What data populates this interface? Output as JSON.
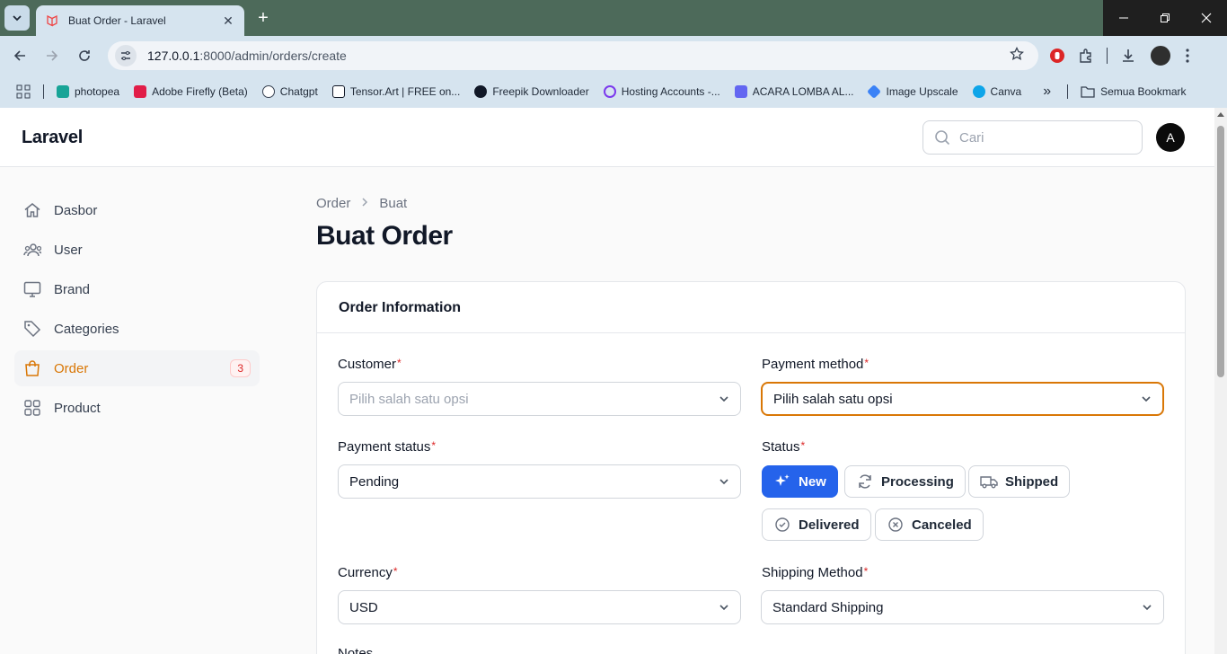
{
  "browser": {
    "tab_title": "Buat Order - Laravel",
    "url_host": "127.0.0.1",
    "url_rest": ":8000/admin/orders/create",
    "bookmarks": [
      {
        "label": "photopea",
        "color": "#18a497"
      },
      {
        "label": "Adobe Firefly (Beta)",
        "color": "#e11d48"
      },
      {
        "label": "Chatgpt",
        "color": "#6b7280"
      },
      {
        "label": "Tensor.Art | FREE on...",
        "color": "#111827"
      },
      {
        "label": "Freepik Downloader",
        "color": "#111827"
      },
      {
        "label": "Hosting Accounts -...",
        "color": "#7c3aed"
      },
      {
        "label": "ACARA LOMBA AL...",
        "color": "#6366f1"
      },
      {
        "label": "Image Upscale",
        "color": "#3b82f6"
      },
      {
        "label": "Canva",
        "color": "#0ea5e9"
      }
    ],
    "all_bookmarks": "Semua Bookmark"
  },
  "app": {
    "brand": "Laravel",
    "search_placeholder": "Cari",
    "user_initial": "A",
    "accent": "#d97706"
  },
  "sidebar": {
    "items": [
      {
        "label": "Dasbor",
        "icon": "home-icon"
      },
      {
        "label": "User",
        "icon": "users-icon"
      },
      {
        "label": "Brand",
        "icon": "monitor-icon"
      },
      {
        "label": "Categories",
        "icon": "tag-icon"
      },
      {
        "label": "Order",
        "icon": "shopping-bag-icon",
        "badge": "3",
        "active": true
      },
      {
        "label": "Product",
        "icon": "grid-icon"
      }
    ]
  },
  "breadcrumb": [
    "Order",
    "Buat"
  ],
  "page_title": "Buat Order",
  "form": {
    "section_title": "Order Information",
    "customer": {
      "label": "Customer",
      "placeholder": "Pilih salah satu opsi"
    },
    "payment_method": {
      "label": "Payment method",
      "value": "Pilih salah satu opsi"
    },
    "payment_status": {
      "label": "Payment status",
      "value": "Pending"
    },
    "status": {
      "label": "Status",
      "options": [
        "New",
        "Processing",
        "Shipped",
        "Delivered",
        "Canceled"
      ],
      "selected": "New",
      "selected_color": "#2563eb"
    },
    "currency": {
      "label": "Currency",
      "value": "USD"
    },
    "shipping_method": {
      "label": "Shipping Method",
      "value": "Standard Shipping"
    },
    "notes": {
      "label": "Notes"
    }
  }
}
